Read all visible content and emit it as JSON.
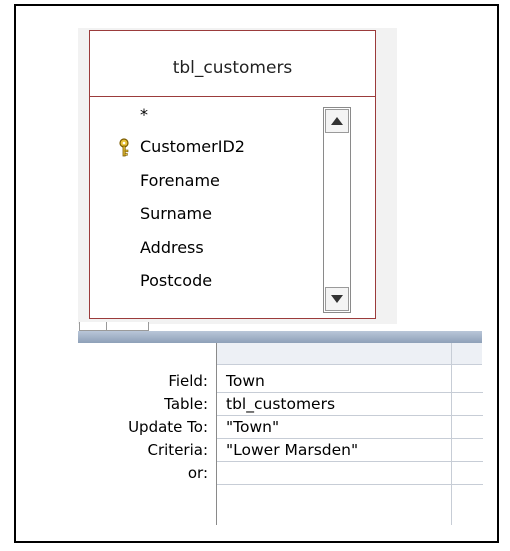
{
  "table": {
    "title": "tbl_customers",
    "fields": [
      {
        "label": "*",
        "key": false
      },
      {
        "label": "CustomerID2",
        "key": true
      },
      {
        "label": "Forename",
        "key": false
      },
      {
        "label": "Surname",
        "key": false
      },
      {
        "label": "Address",
        "key": false
      },
      {
        "label": "Postcode",
        "key": false
      }
    ]
  },
  "grid": {
    "row_labels": {
      "field": "Field:",
      "table": "Table:",
      "update_to": "Update To:",
      "criteria": "Criteria:",
      "or": "or:"
    },
    "column1": {
      "field": "Town",
      "table": "tbl_customers",
      "update_to": "\"Town\"",
      "criteria": "\"Lower Marsden\"",
      "or": ""
    }
  },
  "icons": {
    "primary_key": "key-icon",
    "scroll_up": "scroll-up-arrow-icon",
    "scroll_down": "scroll-down-arrow-icon"
  }
}
